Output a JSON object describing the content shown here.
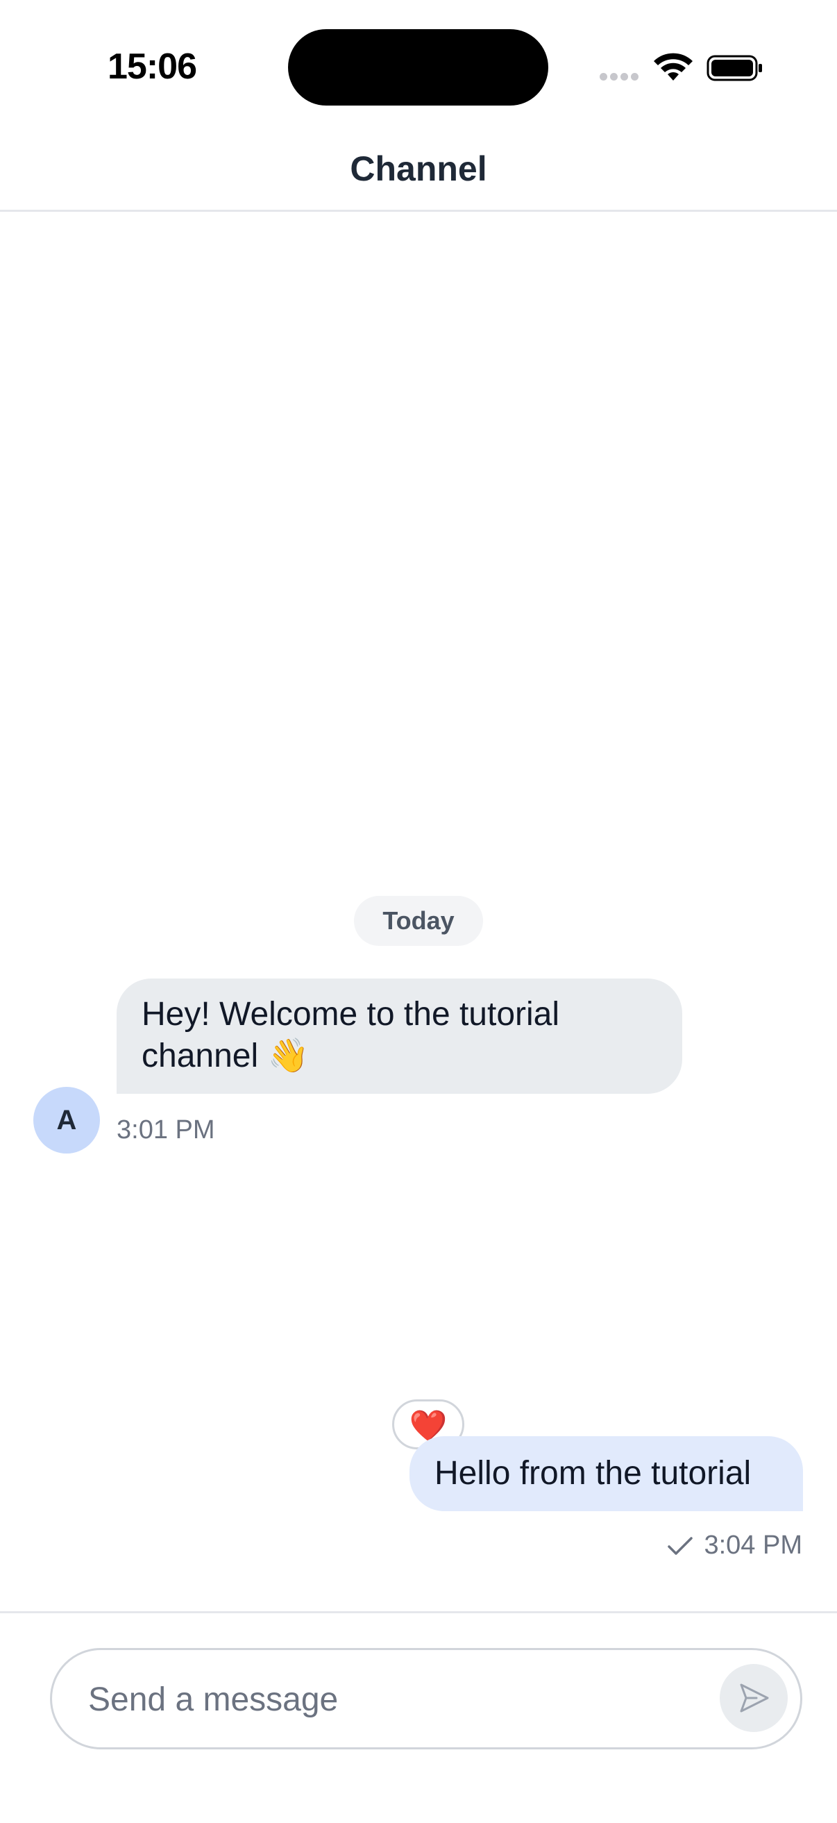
{
  "status_bar": {
    "time": "15:06"
  },
  "header": {
    "title": "Channel"
  },
  "messages": {
    "date_separator": "Today",
    "incoming": {
      "avatar_initial": "A",
      "text": "Hey! Welcome to the tutorial channel 👋",
      "time": "3:01 PM"
    },
    "outgoing": {
      "text": "Hello from the tutorial",
      "reaction": "❤️",
      "time": "3:04 PM",
      "status": "sent"
    }
  },
  "composer": {
    "placeholder": "Send a message"
  },
  "colors": {
    "incoming_bubble": "#e9ecef",
    "outgoing_bubble": "#e1eafc",
    "avatar_bg": "#c7d9fb",
    "muted_text": "#6b7280"
  }
}
